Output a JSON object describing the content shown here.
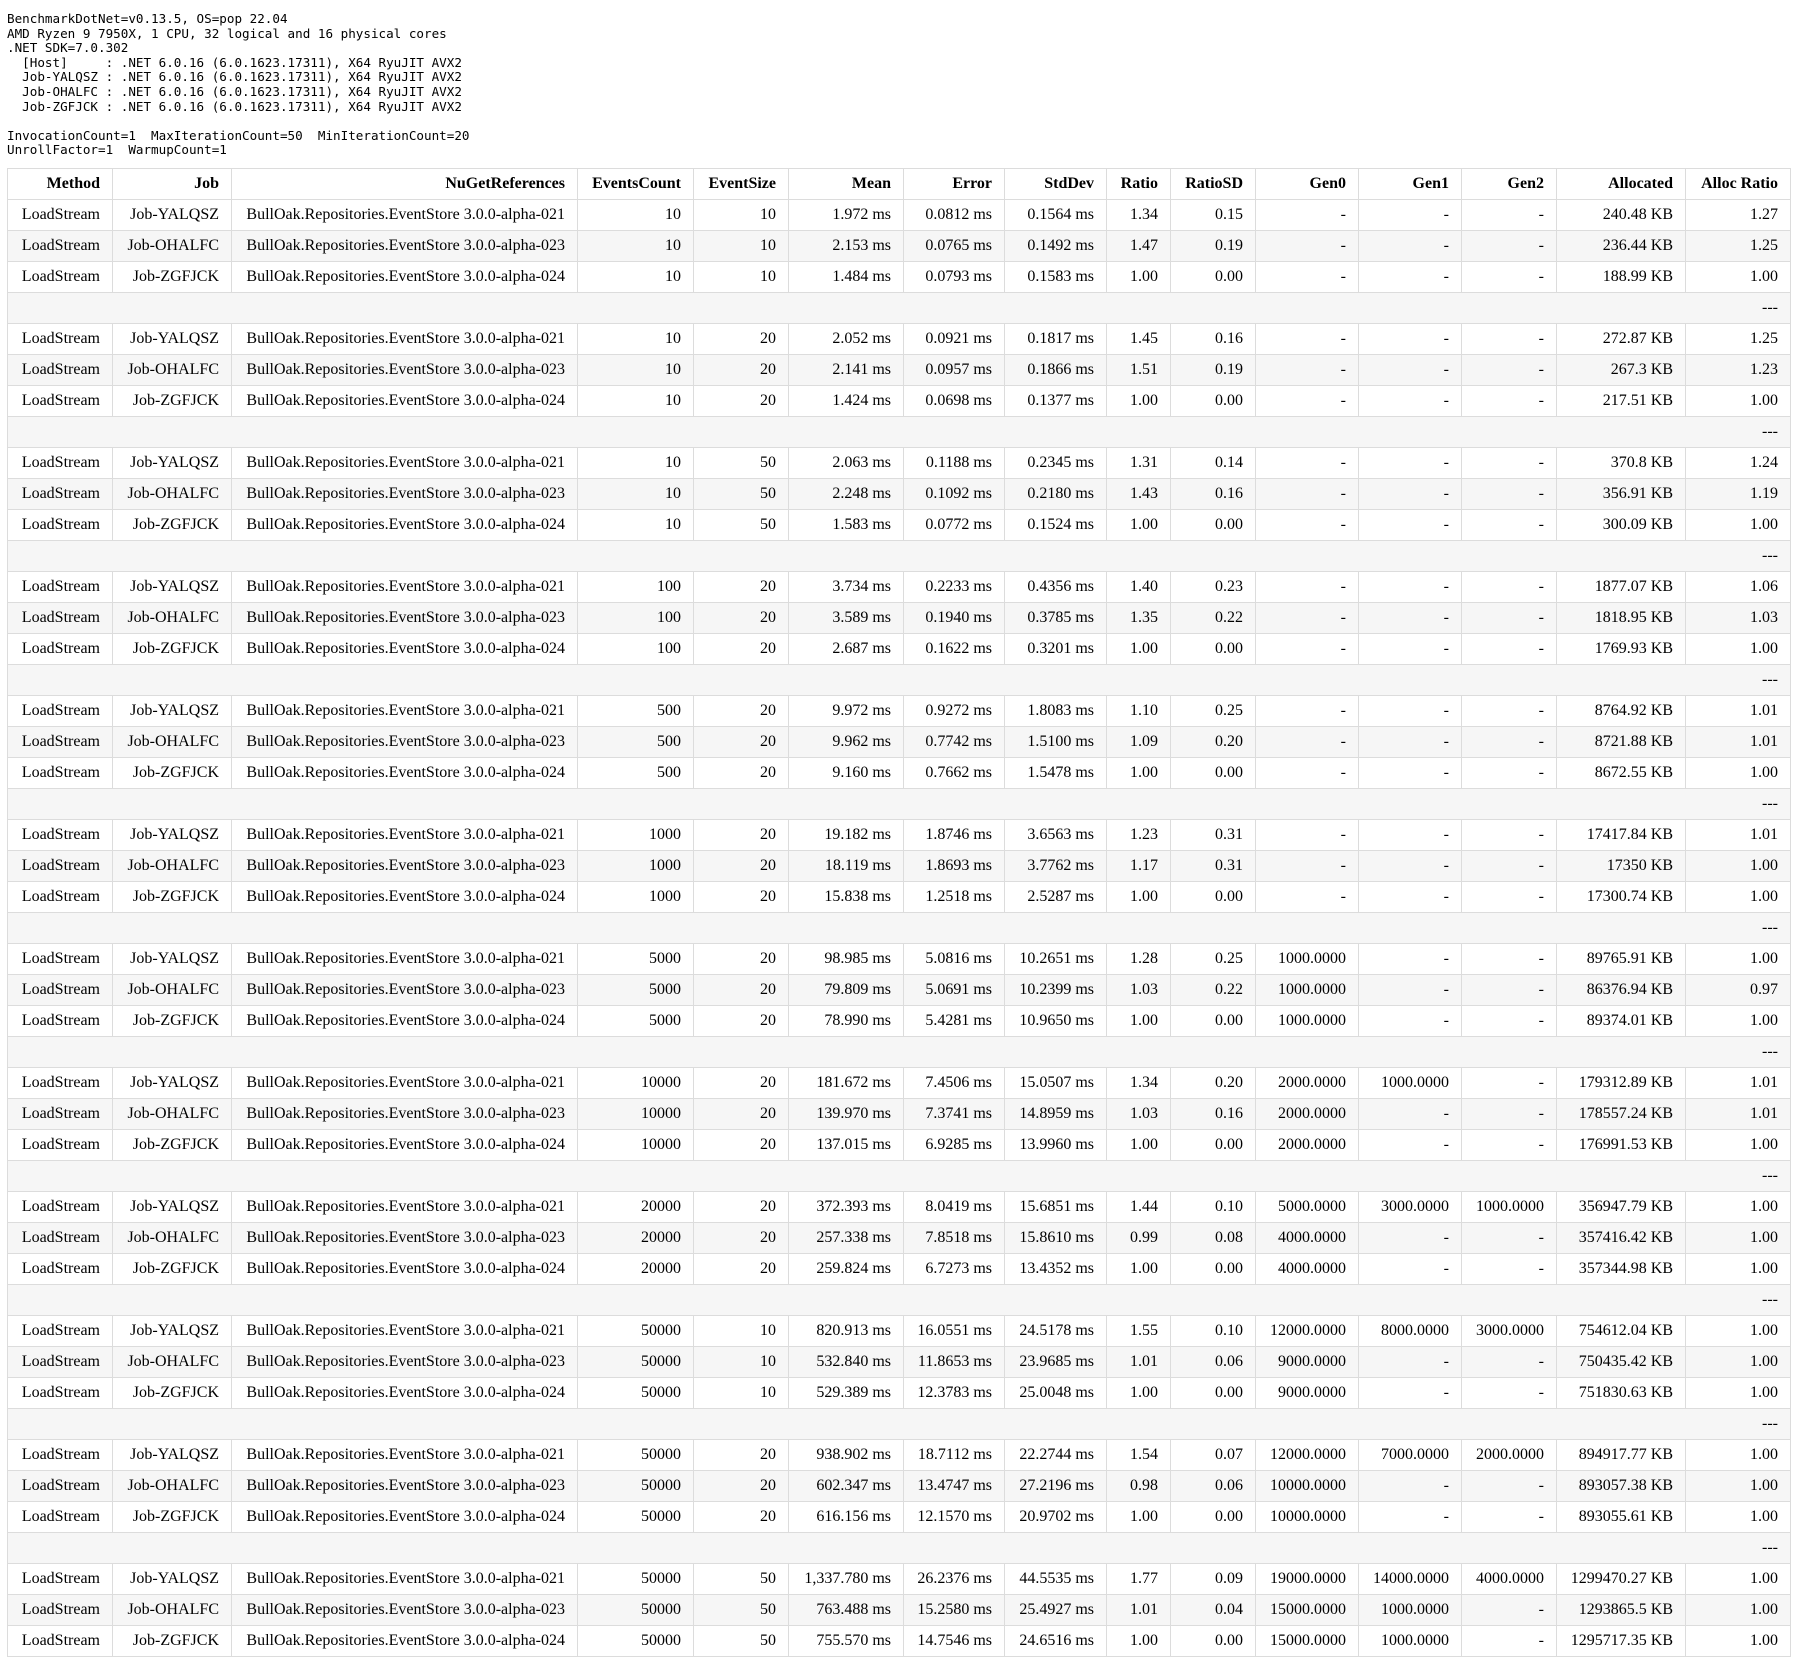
{
  "environment_lines": [
    "BenchmarkDotNet=v0.13.5, OS=pop 22.04",
    "AMD Ryzen 9 7950X, 1 CPU, 32 logical and 16 physical cores",
    ".NET SDK=7.0.302",
    "  [Host]     : .NET 6.0.16 (6.0.1623.17311), X64 RyuJIT AVX2",
    "  Job-YALQSZ : .NET 6.0.16 (6.0.1623.17311), X64 RyuJIT AVX2",
    "  Job-OHALFC : .NET 6.0.16 (6.0.1623.17311), X64 RyuJIT AVX2",
    "  Job-ZGFJCK : .NET 6.0.16 (6.0.1623.17311), X64 RyuJIT AVX2",
    "",
    "InvocationCount=1  MaxIterationCount=50  MinIterationCount=20",
    "UnrollFactor=1  WarmupCount=1"
  ],
  "columns": [
    "Method",
    "Job",
    "NuGetReferences",
    "EventsCount",
    "EventSize",
    "Mean",
    "Error",
    "StdDev",
    "Ratio",
    "RatioSD",
    "Gen0",
    "Gen1",
    "Gen2",
    "Allocated",
    "Alloc Ratio"
  ],
  "separator_text": "---",
  "groups": [
    [
      [
        "LoadStream",
        "Job-YALQSZ",
        "BullOak.Repositories.EventStore 3.0.0-alpha-021",
        "10",
        "10",
        "1.972 ms",
        "0.0812 ms",
        "0.1564 ms",
        "1.34",
        "0.15",
        "-",
        "-",
        "-",
        "240.48 KB",
        "1.27"
      ],
      [
        "LoadStream",
        "Job-OHALFC",
        "BullOak.Repositories.EventStore 3.0.0-alpha-023",
        "10",
        "10",
        "2.153 ms",
        "0.0765 ms",
        "0.1492 ms",
        "1.47",
        "0.19",
        "-",
        "-",
        "-",
        "236.44 KB",
        "1.25"
      ],
      [
        "LoadStream",
        "Job-ZGFJCK",
        "BullOak.Repositories.EventStore 3.0.0-alpha-024",
        "10",
        "10",
        "1.484 ms",
        "0.0793 ms",
        "0.1583 ms",
        "1.00",
        "0.00",
        "-",
        "-",
        "-",
        "188.99 KB",
        "1.00"
      ]
    ],
    [
      [
        "LoadStream",
        "Job-YALQSZ",
        "BullOak.Repositories.EventStore 3.0.0-alpha-021",
        "10",
        "20",
        "2.052 ms",
        "0.0921 ms",
        "0.1817 ms",
        "1.45",
        "0.16",
        "-",
        "-",
        "-",
        "272.87 KB",
        "1.25"
      ],
      [
        "LoadStream",
        "Job-OHALFC",
        "BullOak.Repositories.EventStore 3.0.0-alpha-023",
        "10",
        "20",
        "2.141 ms",
        "0.0957 ms",
        "0.1866 ms",
        "1.51",
        "0.19",
        "-",
        "-",
        "-",
        "267.3 KB",
        "1.23"
      ],
      [
        "LoadStream",
        "Job-ZGFJCK",
        "BullOak.Repositories.EventStore 3.0.0-alpha-024",
        "10",
        "20",
        "1.424 ms",
        "0.0698 ms",
        "0.1377 ms",
        "1.00",
        "0.00",
        "-",
        "-",
        "-",
        "217.51 KB",
        "1.00"
      ]
    ],
    [
      [
        "LoadStream",
        "Job-YALQSZ",
        "BullOak.Repositories.EventStore 3.0.0-alpha-021",
        "10",
        "50",
        "2.063 ms",
        "0.1188 ms",
        "0.2345 ms",
        "1.31",
        "0.14",
        "-",
        "-",
        "-",
        "370.8 KB",
        "1.24"
      ],
      [
        "LoadStream",
        "Job-OHALFC",
        "BullOak.Repositories.EventStore 3.0.0-alpha-023",
        "10",
        "50",
        "2.248 ms",
        "0.1092 ms",
        "0.2180 ms",
        "1.43",
        "0.16",
        "-",
        "-",
        "-",
        "356.91 KB",
        "1.19"
      ],
      [
        "LoadStream",
        "Job-ZGFJCK",
        "BullOak.Repositories.EventStore 3.0.0-alpha-024",
        "10",
        "50",
        "1.583 ms",
        "0.0772 ms",
        "0.1524 ms",
        "1.00",
        "0.00",
        "-",
        "-",
        "-",
        "300.09 KB",
        "1.00"
      ]
    ],
    [
      [
        "LoadStream",
        "Job-YALQSZ",
        "BullOak.Repositories.EventStore 3.0.0-alpha-021",
        "100",
        "20",
        "3.734 ms",
        "0.2233 ms",
        "0.4356 ms",
        "1.40",
        "0.23",
        "-",
        "-",
        "-",
        "1877.07 KB",
        "1.06"
      ],
      [
        "LoadStream",
        "Job-OHALFC",
        "BullOak.Repositories.EventStore 3.0.0-alpha-023",
        "100",
        "20",
        "3.589 ms",
        "0.1940 ms",
        "0.3785 ms",
        "1.35",
        "0.22",
        "-",
        "-",
        "-",
        "1818.95 KB",
        "1.03"
      ],
      [
        "LoadStream",
        "Job-ZGFJCK",
        "BullOak.Repositories.EventStore 3.0.0-alpha-024",
        "100",
        "20",
        "2.687 ms",
        "0.1622 ms",
        "0.3201 ms",
        "1.00",
        "0.00",
        "-",
        "-",
        "-",
        "1769.93 KB",
        "1.00"
      ]
    ],
    [
      [
        "LoadStream",
        "Job-YALQSZ",
        "BullOak.Repositories.EventStore 3.0.0-alpha-021",
        "500",
        "20",
        "9.972 ms",
        "0.9272 ms",
        "1.8083 ms",
        "1.10",
        "0.25",
        "-",
        "-",
        "-",
        "8764.92 KB",
        "1.01"
      ],
      [
        "LoadStream",
        "Job-OHALFC",
        "BullOak.Repositories.EventStore 3.0.0-alpha-023",
        "500",
        "20",
        "9.962 ms",
        "0.7742 ms",
        "1.5100 ms",
        "1.09",
        "0.20",
        "-",
        "-",
        "-",
        "8721.88 KB",
        "1.01"
      ],
      [
        "LoadStream",
        "Job-ZGFJCK",
        "BullOak.Repositories.EventStore 3.0.0-alpha-024",
        "500",
        "20",
        "9.160 ms",
        "0.7662 ms",
        "1.5478 ms",
        "1.00",
        "0.00",
        "-",
        "-",
        "-",
        "8672.55 KB",
        "1.00"
      ]
    ],
    [
      [
        "LoadStream",
        "Job-YALQSZ",
        "BullOak.Repositories.EventStore 3.0.0-alpha-021",
        "1000",
        "20",
        "19.182 ms",
        "1.8746 ms",
        "3.6563 ms",
        "1.23",
        "0.31",
        "-",
        "-",
        "-",
        "17417.84 KB",
        "1.01"
      ],
      [
        "LoadStream",
        "Job-OHALFC",
        "BullOak.Repositories.EventStore 3.0.0-alpha-023",
        "1000",
        "20",
        "18.119 ms",
        "1.8693 ms",
        "3.7762 ms",
        "1.17",
        "0.31",
        "-",
        "-",
        "-",
        "17350 KB",
        "1.00"
      ],
      [
        "LoadStream",
        "Job-ZGFJCK",
        "BullOak.Repositories.EventStore 3.0.0-alpha-024",
        "1000",
        "20",
        "15.838 ms",
        "1.2518 ms",
        "2.5287 ms",
        "1.00",
        "0.00",
        "-",
        "-",
        "-",
        "17300.74 KB",
        "1.00"
      ]
    ],
    [
      [
        "LoadStream",
        "Job-YALQSZ",
        "BullOak.Repositories.EventStore 3.0.0-alpha-021",
        "5000",
        "20",
        "98.985 ms",
        "5.0816 ms",
        "10.2651 ms",
        "1.28",
        "0.25",
        "1000.0000",
        "-",
        "-",
        "89765.91 KB",
        "1.00"
      ],
      [
        "LoadStream",
        "Job-OHALFC",
        "BullOak.Repositories.EventStore 3.0.0-alpha-023",
        "5000",
        "20",
        "79.809 ms",
        "5.0691 ms",
        "10.2399 ms",
        "1.03",
        "0.22",
        "1000.0000",
        "-",
        "-",
        "86376.94 KB",
        "0.97"
      ],
      [
        "LoadStream",
        "Job-ZGFJCK",
        "BullOak.Repositories.EventStore 3.0.0-alpha-024",
        "5000",
        "20",
        "78.990 ms",
        "5.4281 ms",
        "10.9650 ms",
        "1.00",
        "0.00",
        "1000.0000",
        "-",
        "-",
        "89374.01 KB",
        "1.00"
      ]
    ],
    [
      [
        "LoadStream",
        "Job-YALQSZ",
        "BullOak.Repositories.EventStore 3.0.0-alpha-021",
        "10000",
        "20",
        "181.672 ms",
        "7.4506 ms",
        "15.0507 ms",
        "1.34",
        "0.20",
        "2000.0000",
        "1000.0000",
        "-",
        "179312.89 KB",
        "1.01"
      ],
      [
        "LoadStream",
        "Job-OHALFC",
        "BullOak.Repositories.EventStore 3.0.0-alpha-023",
        "10000",
        "20",
        "139.970 ms",
        "7.3741 ms",
        "14.8959 ms",
        "1.03",
        "0.16",
        "2000.0000",
        "-",
        "-",
        "178557.24 KB",
        "1.01"
      ],
      [
        "LoadStream",
        "Job-ZGFJCK",
        "BullOak.Repositories.EventStore 3.0.0-alpha-024",
        "10000",
        "20",
        "137.015 ms",
        "6.9285 ms",
        "13.9960 ms",
        "1.00",
        "0.00",
        "2000.0000",
        "-",
        "-",
        "176991.53 KB",
        "1.00"
      ]
    ],
    [
      [
        "LoadStream",
        "Job-YALQSZ",
        "BullOak.Repositories.EventStore 3.0.0-alpha-021",
        "20000",
        "20",
        "372.393 ms",
        "8.0419 ms",
        "15.6851 ms",
        "1.44",
        "0.10",
        "5000.0000",
        "3000.0000",
        "1000.0000",
        "356947.79 KB",
        "1.00"
      ],
      [
        "LoadStream",
        "Job-OHALFC",
        "BullOak.Repositories.EventStore 3.0.0-alpha-023",
        "20000",
        "20",
        "257.338 ms",
        "7.8518 ms",
        "15.8610 ms",
        "0.99",
        "0.08",
        "4000.0000",
        "-",
        "-",
        "357416.42 KB",
        "1.00"
      ],
      [
        "LoadStream",
        "Job-ZGFJCK",
        "BullOak.Repositories.EventStore 3.0.0-alpha-024",
        "20000",
        "20",
        "259.824 ms",
        "6.7273 ms",
        "13.4352 ms",
        "1.00",
        "0.00",
        "4000.0000",
        "-",
        "-",
        "357344.98 KB",
        "1.00"
      ]
    ],
    [
      [
        "LoadStream",
        "Job-YALQSZ",
        "BullOak.Repositories.EventStore 3.0.0-alpha-021",
        "50000",
        "10",
        "820.913 ms",
        "16.0551 ms",
        "24.5178 ms",
        "1.55",
        "0.10",
        "12000.0000",
        "8000.0000",
        "3000.0000",
        "754612.04 KB",
        "1.00"
      ],
      [
        "LoadStream",
        "Job-OHALFC",
        "BullOak.Repositories.EventStore 3.0.0-alpha-023",
        "50000",
        "10",
        "532.840 ms",
        "11.8653 ms",
        "23.9685 ms",
        "1.01",
        "0.06",
        "9000.0000",
        "-",
        "-",
        "750435.42 KB",
        "1.00"
      ],
      [
        "LoadStream",
        "Job-ZGFJCK",
        "BullOak.Repositories.EventStore 3.0.0-alpha-024",
        "50000",
        "10",
        "529.389 ms",
        "12.3783 ms",
        "25.0048 ms",
        "1.00",
        "0.00",
        "9000.0000",
        "-",
        "-",
        "751830.63 KB",
        "1.00"
      ]
    ],
    [
      [
        "LoadStream",
        "Job-YALQSZ",
        "BullOak.Repositories.EventStore 3.0.0-alpha-021",
        "50000",
        "20",
        "938.902 ms",
        "18.7112 ms",
        "22.2744 ms",
        "1.54",
        "0.07",
        "12000.0000",
        "7000.0000",
        "2000.0000",
        "894917.77 KB",
        "1.00"
      ],
      [
        "LoadStream",
        "Job-OHALFC",
        "BullOak.Repositories.EventStore 3.0.0-alpha-023",
        "50000",
        "20",
        "602.347 ms",
        "13.4747 ms",
        "27.2196 ms",
        "0.98",
        "0.06",
        "10000.0000",
        "-",
        "-",
        "893057.38 KB",
        "1.00"
      ],
      [
        "LoadStream",
        "Job-ZGFJCK",
        "BullOak.Repositories.EventStore 3.0.0-alpha-024",
        "50000",
        "20",
        "616.156 ms",
        "12.1570 ms",
        "20.9702 ms",
        "1.00",
        "0.00",
        "10000.0000",
        "-",
        "-",
        "893055.61 KB",
        "1.00"
      ]
    ],
    [
      [
        "LoadStream",
        "Job-YALQSZ",
        "BullOak.Repositories.EventStore 3.0.0-alpha-021",
        "50000",
        "50",
        "1,337.780 ms",
        "26.2376 ms",
        "44.5535 ms",
        "1.77",
        "0.09",
        "19000.0000",
        "14000.0000",
        "4000.0000",
        "1299470.27 KB",
        "1.00"
      ],
      [
        "LoadStream",
        "Job-OHALFC",
        "BullOak.Repositories.EventStore 3.0.0-alpha-023",
        "50000",
        "50",
        "763.488 ms",
        "15.2580 ms",
        "25.4927 ms",
        "1.01",
        "0.04",
        "15000.0000",
        "1000.0000",
        "-",
        "1293865.5 KB",
        "1.00"
      ],
      [
        "LoadStream",
        "Job-ZGFJCK",
        "BullOak.Repositories.EventStore 3.0.0-alpha-024",
        "50000",
        "50",
        "755.570 ms",
        "14.7546 ms",
        "24.6516 ms",
        "1.00",
        "0.00",
        "15000.0000",
        "1000.0000",
        "-",
        "1295717.35 KB",
        "1.00"
      ]
    ]
  ]
}
